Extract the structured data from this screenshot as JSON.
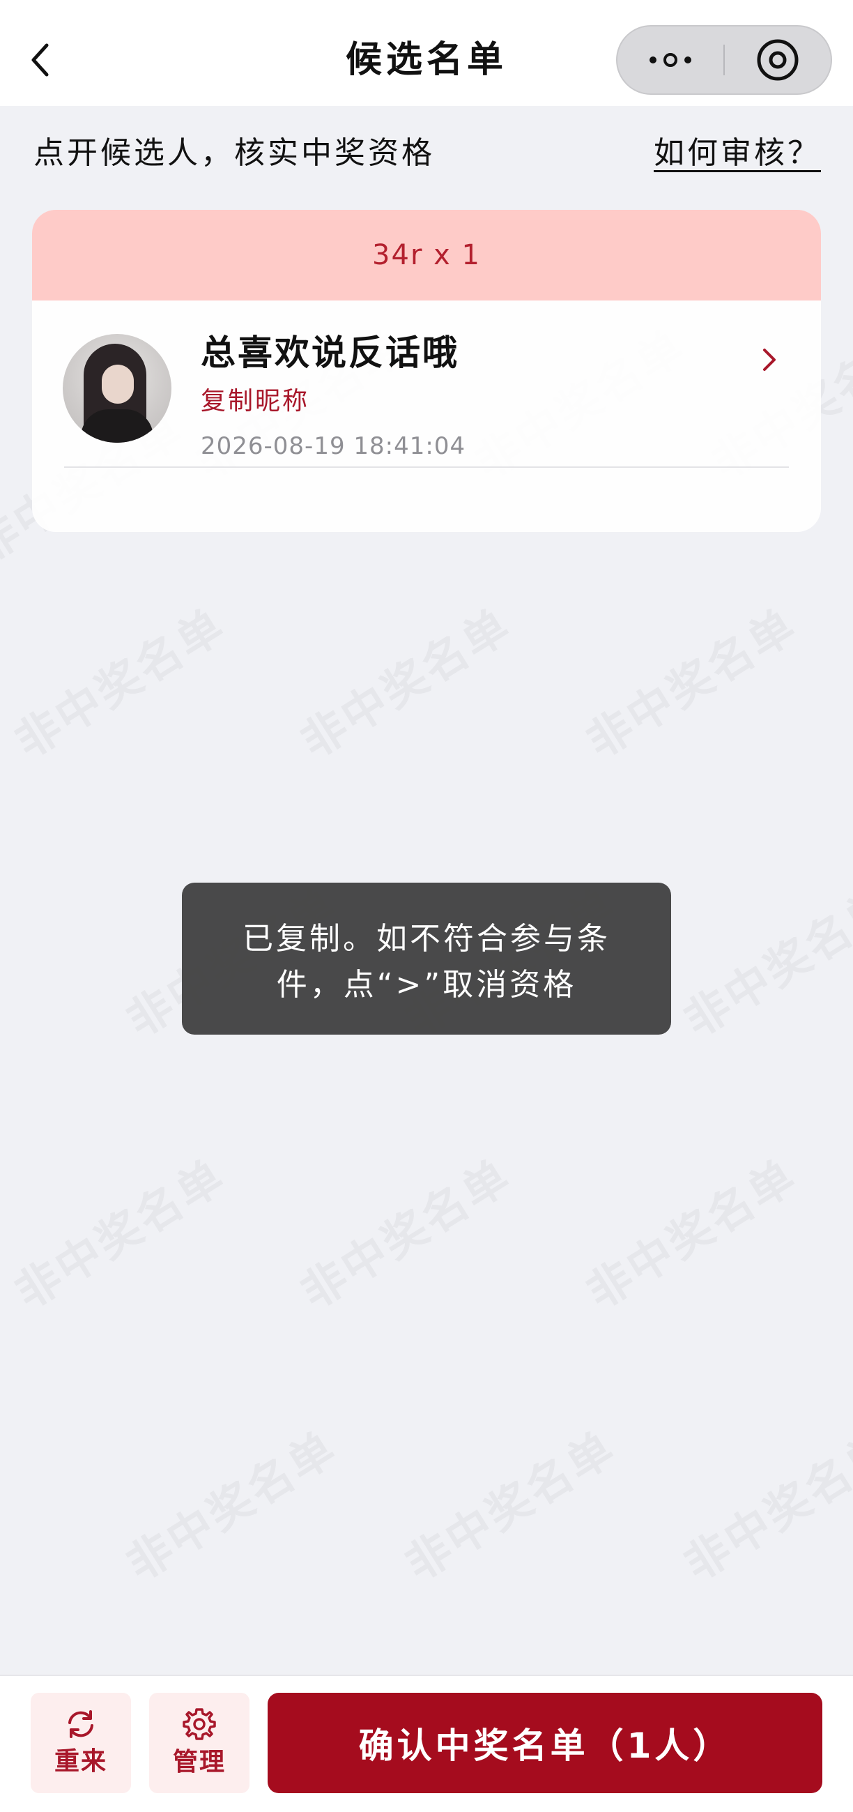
{
  "navbar": {
    "title": "候选名单"
  },
  "intro": {
    "text": "点开候选人，核实中奖资格",
    "help_link": "如何审核？"
  },
  "card": {
    "header": "34r x 1",
    "entries": [
      {
        "nickname": "总喜欢说反话哦",
        "copy_label": "复制昵称",
        "timestamp": "2026-08-19 18:41:04"
      }
    ]
  },
  "toast": {
    "line1": "已复制。如不符合参与条",
    "line2": "件，点“>”取消资格"
  },
  "bottom_bar": {
    "reset_label": "重来",
    "manage_label": "管理",
    "confirm_label": "确认中奖名单（1人）"
  },
  "watermark_text": "非中奖名单",
  "colors": {
    "accent": "#a50c1e",
    "card_header_bg": "#fecbc8",
    "page_bg": "#f0f1f5",
    "toast_bg": "#3c3c3c"
  },
  "icons": [
    "back-chevron-icon",
    "more-dots-icon",
    "close-circle-icon",
    "right-chevron-icon",
    "refresh-icon",
    "gear-icon"
  ]
}
